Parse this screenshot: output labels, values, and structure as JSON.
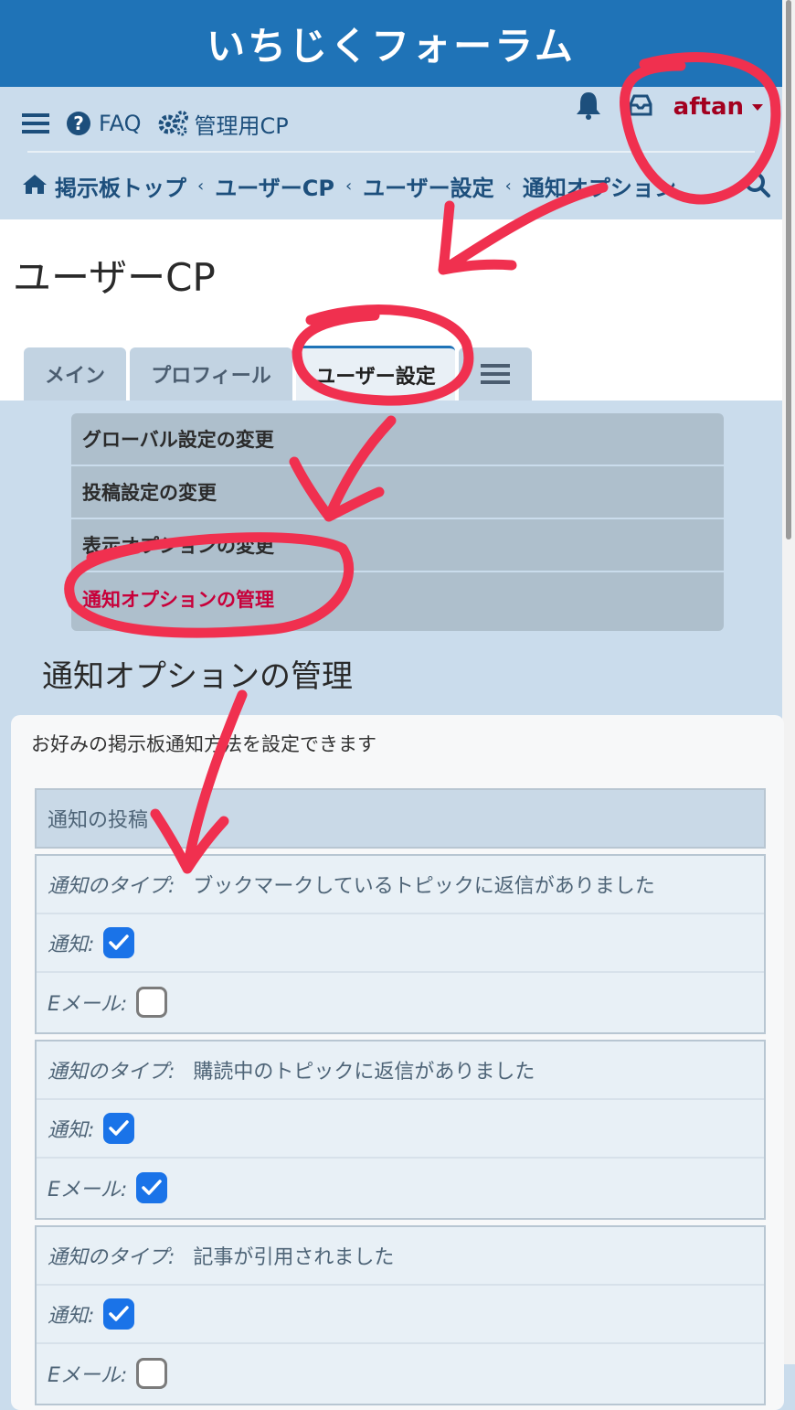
{
  "header": {
    "site_title": "いちじくフォーラム"
  },
  "nav": {
    "menu_icon": "hamburger-menu-icon",
    "faq_label": "FAQ",
    "admin_cp_label": "管理用CP",
    "notifications_icon": "bell-icon",
    "inbox_icon": "inbox-icon",
    "username": "aftan"
  },
  "breadcrumb": {
    "items": [
      "掲示板トップ",
      "ユーザーCP",
      "ユーザー設定",
      "通知オプション"
    ],
    "home_icon": "home-icon",
    "search_icon": "search-icon"
  },
  "page": {
    "title": "ユーザーCP"
  },
  "tabs": [
    {
      "label": "メイン",
      "active": false
    },
    {
      "label": "プロフィール",
      "active": false
    },
    {
      "label": "ユーザー設定",
      "active": true
    }
  ],
  "tabs_more_icon": "hamburger-menu-icon",
  "submenu": {
    "items": [
      {
        "label": "グローバル設定の変更",
        "active": false
      },
      {
        "label": "投稿設定の変更",
        "active": false
      },
      {
        "label": "表示オプションの変更",
        "active": false
      },
      {
        "label": "通知オプションの管理",
        "active": true
      }
    ]
  },
  "section": {
    "title": "通知オプションの管理",
    "description": "お好みの掲示板通知方法を設定できます",
    "group_title": "通知の投稿",
    "type_label": "通知のタイプ:",
    "notify_label": "通知:",
    "email_label": "Eメール:",
    "notification_types": [
      {
        "name": "ブックマークしているトピックに返信がありました",
        "notify": true,
        "email": false
      },
      {
        "name": "購読中のトピックに返信がありました",
        "notify": true,
        "email": true
      },
      {
        "name": "記事が引用されました",
        "notify": true,
        "email": false
      }
    ]
  },
  "colors": {
    "header_bg": "#1f73b7",
    "nav_bg": "#cadcec",
    "username": "#a3001f",
    "active_menu": "#c8003a",
    "checkbox_checked": "#1a73e8",
    "annotation": "#f0304f"
  }
}
